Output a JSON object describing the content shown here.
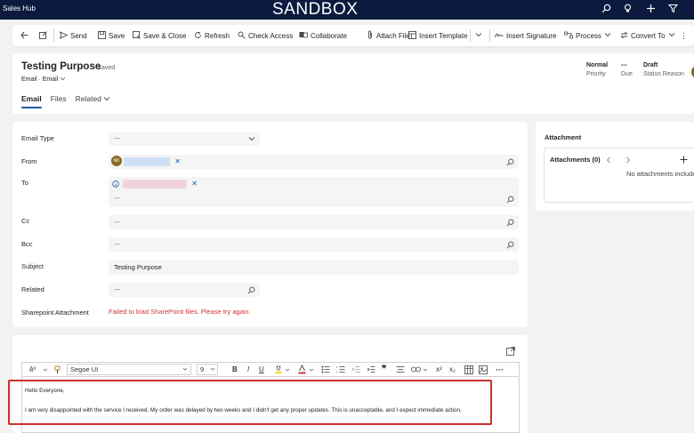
{
  "topbar": {
    "app_name": "Sales Hub",
    "environment": "SANDBOX",
    "icons": [
      "search-icon",
      "lightbulb-icon",
      "plus-icon",
      "filter-icon"
    ]
  },
  "commands": {
    "back": "back-arrow-icon",
    "popout": "popout-icon",
    "send": "Send",
    "save": "Save",
    "save_close": "Save & Close",
    "refresh": "Refresh",
    "check_access": "Check Access",
    "collaborate": "Collaborate",
    "attach_file": "Attach File",
    "insert_template": "Insert Template",
    "insert_signature": "Insert Signature",
    "process": "Process",
    "convert_to": "Convert To"
  },
  "header": {
    "title": "Testing Purpose",
    "saved": "- Saved",
    "entity": "Email",
    "form": "Email",
    "priority_value": "Normal",
    "priority_label": "Priority",
    "due_value": "---",
    "due_label": "Due",
    "status_value": "Draft",
    "status_label": "Status Reason",
    "tabs": [
      "Email",
      "Files",
      "Related"
    ]
  },
  "form": {
    "email_type_label": "Email Type",
    "email_type_value": "---",
    "from_label": "From",
    "from_initials": "NK",
    "to_label": "To",
    "to_placeholder": "---",
    "cc_label": "Cc",
    "cc_value": "---",
    "bcc_label": "Bcc",
    "bcc_value": "---",
    "subject_label": "Subject",
    "subject_value": "Testing Purpose",
    "related_label": "Related",
    "related_value": "---",
    "sharepoint_label": "Sharepoint Attachment",
    "sharepoint_error": "Failed to load SharePoint files. Please try again."
  },
  "attachment": {
    "title": "Attachment",
    "count_label": "Attachments (0)",
    "empty_text": "No attachments include"
  },
  "editor": {
    "font": "Segoe UI",
    "size": "9",
    "greeting": "Hello Everyone,",
    "body": "I am very disappointed with the service I received. My order was delayed by two weeks and I didn't get any proper updates. This is unacceptable, and I expect immediate action."
  }
}
